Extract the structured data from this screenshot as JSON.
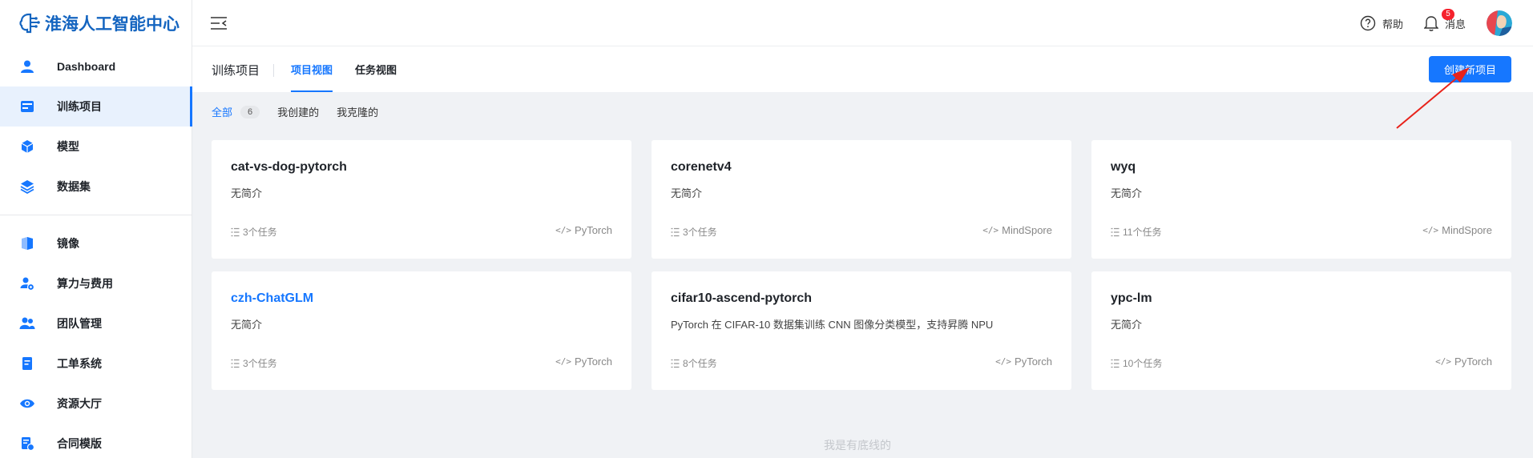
{
  "sidebar": {
    "logo_text": "淮海人工智能中心",
    "items": [
      {
        "label": "Dashboard",
        "icon": "user-icon"
      },
      {
        "label": "训练项目",
        "icon": "training-icon",
        "active": true
      },
      {
        "label": "模型",
        "icon": "cube-icon"
      },
      {
        "label": "数据集",
        "icon": "layers-icon"
      },
      {
        "label": "镜像",
        "icon": "image-icon"
      },
      {
        "label": "算力与费用",
        "icon": "compute-icon"
      },
      {
        "label": "团队管理",
        "icon": "team-icon"
      },
      {
        "label": "工单系统",
        "icon": "ticket-icon"
      },
      {
        "label": "资源大厅",
        "icon": "eye-icon"
      },
      {
        "label": "合同模版",
        "icon": "contract-icon"
      }
    ]
  },
  "header": {
    "help_label": "帮助",
    "messages_label": "消息",
    "messages_badge": "5"
  },
  "subheader": {
    "title": "训练项目",
    "tabs": [
      {
        "label": "项目视图",
        "active": true
      },
      {
        "label": "任务视图",
        "active": false
      }
    ],
    "create_button": "创建新项目"
  },
  "filters": [
    {
      "label": "全部",
      "count": "6",
      "active": true
    },
    {
      "label": "我创建的"
    },
    {
      "label": "我克隆的"
    }
  ],
  "projects": [
    {
      "title": "cat-vs-dog-pytorch",
      "desc": "无简介",
      "tasks": "3个任务",
      "framework": "PyTorch"
    },
    {
      "title": "corenetv4",
      "desc": "无简介",
      "tasks": "3个任务",
      "framework": "MindSpore"
    },
    {
      "title": "wyq",
      "desc": "无简介",
      "tasks": "11个任务",
      "framework": "MindSpore"
    },
    {
      "title": "czh-ChatGLM",
      "desc": "无简介",
      "tasks": "3个任务",
      "framework": "PyTorch",
      "highlight": true
    },
    {
      "title": "cifar10-ascend-pytorch",
      "desc": "PyTorch 在 CIFAR-10 数据集训练 CNN 图像分类模型，支持昇腾 NPU",
      "tasks": "8个任务",
      "framework": "PyTorch"
    },
    {
      "title": "ypc-lm",
      "desc": "无简介",
      "tasks": "10个任务",
      "framework": "PyTorch"
    }
  ],
  "footer_text": "我是有底线的",
  "colors": {
    "accent": "#1677ff",
    "brand": "#1565c0",
    "badge": "#f5222d",
    "annotation_arrow": "#e8231b"
  }
}
